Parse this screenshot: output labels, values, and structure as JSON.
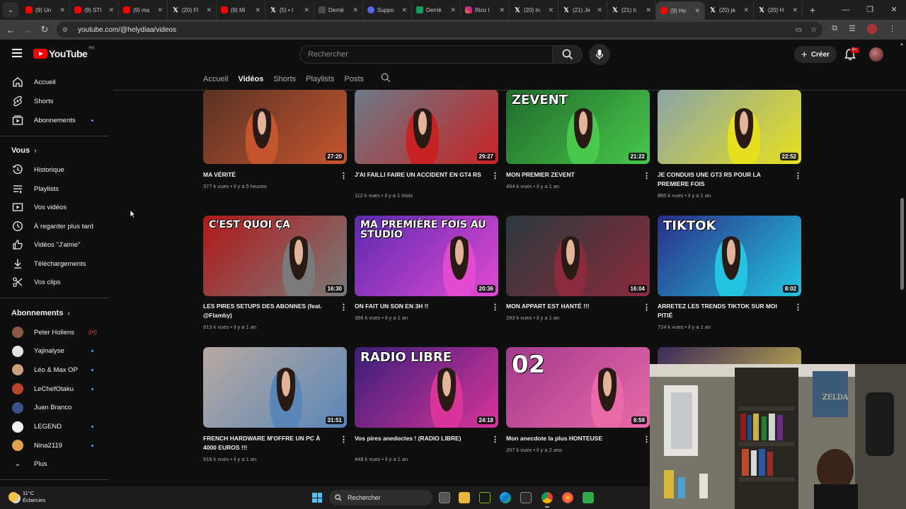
{
  "browser": {
    "tabs": [
      {
        "label": "(9) Un",
        "icon": "youtube-icon"
      },
      {
        "label": "(9) STI",
        "icon": "youtube-icon"
      },
      {
        "label": "(9) ma",
        "icon": "youtube-icon"
      },
      {
        "label": "(20) Fl",
        "icon": "x-icon"
      },
      {
        "label": "(9) Mi",
        "icon": "youtube-icon"
      },
      {
        "label": "(5) • I",
        "icon": "x-icon"
      },
      {
        "label": "Derriè",
        "icon": "doc-icon"
      },
      {
        "label": "Suppo",
        "icon": "support-icon"
      },
      {
        "label": "Derriè",
        "icon": "sheet-icon"
      },
      {
        "label": "Rico I",
        "icon": "instagram-icon"
      },
      {
        "label": "(20) In",
        "icon": "x-icon"
      },
      {
        "label": "(21) Je",
        "icon": "x-icon"
      },
      {
        "label": "(21) h",
        "icon": "x-icon"
      },
      {
        "label": "(9) He",
        "icon": "youtube-icon",
        "active": true
      },
      {
        "label": "(20) ja",
        "icon": "x-icon"
      },
      {
        "label": "(20) H",
        "icon": "x-icon"
      }
    ],
    "url": "youtube.com/@helydiaa/videos"
  },
  "youtube": {
    "logo_text": "YouTube",
    "country_code": "FR",
    "search_placeholder": "Rechercher",
    "create_label": "Créer",
    "notification_badge": "9+"
  },
  "sidebar": {
    "main": [
      {
        "label": "Accueil",
        "icon": "home-icon"
      },
      {
        "label": "Shorts",
        "icon": "shorts-icon"
      },
      {
        "label": "Abonnements",
        "icon": "subscriptions-icon",
        "dot": true
      }
    ],
    "you_heading": "Vous",
    "you": [
      {
        "label": "Historique",
        "icon": "history-icon"
      },
      {
        "label": "Playlists",
        "icon": "playlists-icon"
      },
      {
        "label": "Vos vidéos",
        "icon": "your-videos-icon"
      },
      {
        "label": "À regarder plus tard",
        "icon": "watch-later-icon"
      },
      {
        "label": "Vidéos \"J'aime\"",
        "icon": "like-icon"
      },
      {
        "label": "Téléchargements",
        "icon": "download-icon"
      },
      {
        "label": "Vos clips",
        "icon": "clips-icon"
      }
    ],
    "subs_heading": "Abonnements",
    "subs": [
      {
        "label": "Peter Hollens",
        "indicator": "live",
        "color": "#8a5a44"
      },
      {
        "label": "Yajinalyse",
        "indicator": "dot",
        "color": "#dfe3ea"
      },
      {
        "label": "Léo & Max OP",
        "indicator": "dot",
        "color": "#c9a27a"
      },
      {
        "label": "LeChefOtaku",
        "indicator": "dot",
        "color": "#b8462e"
      },
      {
        "label": "Juan Branco",
        "indicator": "none",
        "color": "#3d4f8c"
      },
      {
        "label": "LEGEND",
        "indicator": "dot",
        "color": "#f1f1f1"
      },
      {
        "label": "Nina2119",
        "indicator": "dot",
        "color": "#e0a14d"
      }
    ],
    "more_label": "Plus"
  },
  "channel_tabs": [
    "Accueil",
    "Vidéos",
    "Shorts",
    "Playlists",
    "Posts"
  ],
  "active_tab": "Vidéos",
  "videos": [
    {
      "title": "MA VÉRITÉ",
      "views": "377 k vues",
      "age": "il y a 5 heures",
      "duration": "27:20",
      "bg": "#5a3224",
      "accent": "#c4552d"
    },
    {
      "title": "J'AI FAILLI FAIRE UN ACCIDENT EN GT4 RS",
      "views": "112 k vues",
      "age": "il y a 1 mois",
      "duration": "29:27",
      "bg": "#6c7a88",
      "accent": "#c82323"
    },
    {
      "title": "MON PREMIER ZEVENT",
      "views": "464 k vues",
      "age": "il y a 1 an",
      "duration": "21:22",
      "bg": "#1f6a2a",
      "accent": "#48c84c",
      "overlay": "ZEVENT"
    },
    {
      "title": "JE CONDUIS UNE GT3 RS POUR LA PREMIERE FOIS",
      "views": "860 k vues",
      "age": "il y a 1 an",
      "duration": "22:52",
      "bg": "#8aa4a8",
      "accent": "#e7e01e"
    },
    {
      "title": "LES PIRES SETUPS DES ABONNES (feat. @Flamby)",
      "views": "913 k vues",
      "age": "il y a 1 an",
      "duration": "16:30",
      "bg": "#b11818",
      "accent": "#7a7a7a",
      "overlay": "C'EST QUOI ÇA"
    },
    {
      "title": "ON FAIT UN SON EN 3H !!",
      "views": "356 k vues",
      "age": "il y a 1 an",
      "duration": "20:36",
      "bg": "#5a2ab0",
      "accent": "#e24ad1",
      "overlay": "MA PREMIÈRE FOIS AU STUDIO"
    },
    {
      "title": "MON APPART EST HANTÉ !!!",
      "views": "293 k vues",
      "age": "il y a 1 an",
      "duration": "16:04",
      "bg": "#2b3a3e",
      "accent": "#8a2a3c"
    },
    {
      "title": "ARRETEZ LES TRENDS TIKTOK SUR MOI PITIÉ",
      "views": "724 k vues",
      "age": "il y a 1 an",
      "duration": "8:02",
      "bg": "#2a2e88",
      "accent": "#22c4e0",
      "overlay": "TIKTOK"
    },
    {
      "title": "FRENCH HARDWARE M'OFFRE UN PC À 4000 EUROS !!!",
      "views": "918 k vues",
      "age": "il y a 1 an",
      "duration": "31:51",
      "bg": "#b8aaa2",
      "accent": "#5a86b8"
    },
    {
      "title": "Vos pires anedoctes ! (RADIO LIBRE)",
      "views": "448 k vues",
      "age": "il y a 1 an",
      "duration": "24:18",
      "bg": "#3a1e7a",
      "accent": "#d8349a",
      "overlay": "RADIO LIBRE"
    },
    {
      "title": "Mon anecdote la plus HONTEUSE",
      "views": "207 k vues",
      "age": "il y a 2 ans",
      "duration": "6:59",
      "bg": "#a23a8c",
      "accent": "#e86aa8",
      "overlay": "02"
    },
    {
      "title": "",
      "views": "",
      "age": "",
      "duration": "",
      "bg": "#3a2a5a",
      "accent": "#d8c64a"
    }
  ],
  "taskbar": {
    "temperature": "11°C",
    "weather": "Éclaircies",
    "search_label": "Rechercher"
  }
}
